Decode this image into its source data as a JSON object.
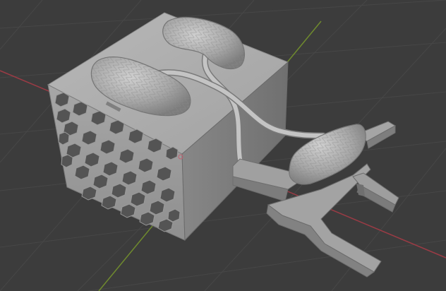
{
  "viewport": {
    "background": "#3c3c3c",
    "grid_color": "#444444",
    "x_axis_color": "#9a3b45",
    "y_axis_color": "#6f8a2e",
    "model_color": "#a8a8a8"
  },
  "scene_objects": [
    "hexagon-vent-box",
    "lung-model-left",
    "lung-model-top",
    "tube-left",
    "tube-right",
    "lung-model-right",
    "clip-stand"
  ]
}
